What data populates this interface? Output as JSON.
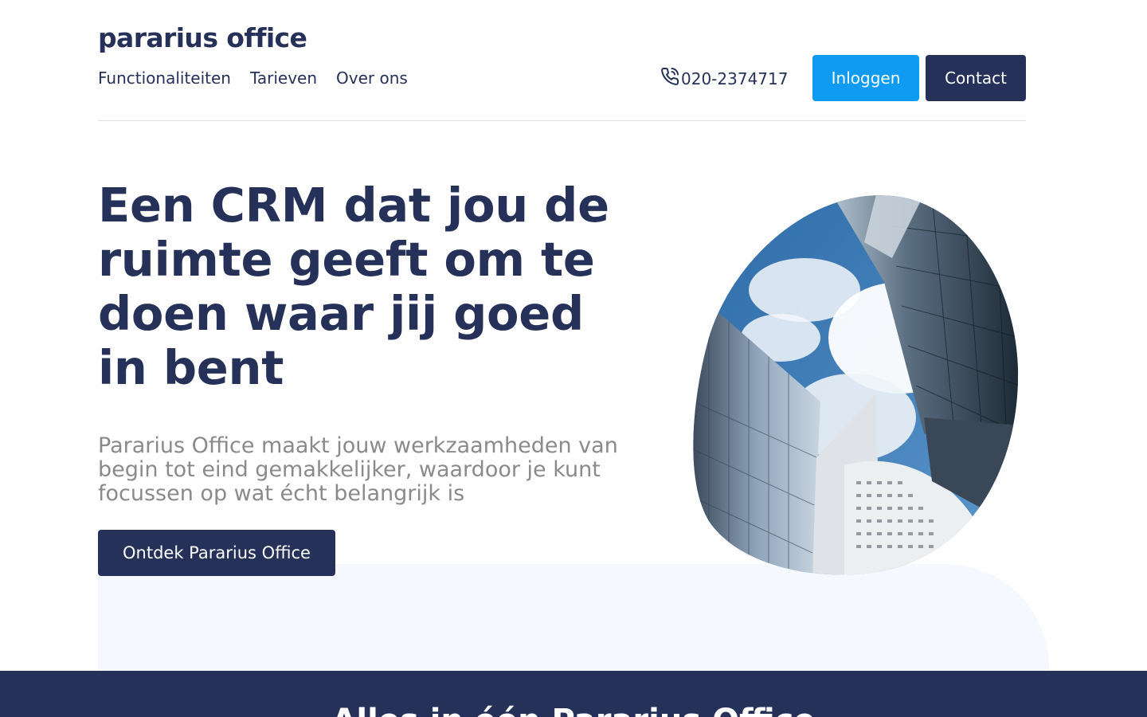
{
  "brand": {
    "logo_text": "pararius office",
    "accent_color": "#0f9bf2",
    "primary_color": "#26315a"
  },
  "nav": {
    "items": [
      {
        "label": "Functionaliteiten"
      },
      {
        "label": "Tarieven"
      },
      {
        "label": "Over ons"
      }
    ]
  },
  "header": {
    "phone_icon": "phone-icon",
    "phone": "020-2374717",
    "login_label": "Inloggen",
    "contact_label": "Contact"
  },
  "hero": {
    "title": "Een CRM dat jou de ruimte geeft om te doen waar jij goed in bent",
    "subtitle": "Pararius Office maakt jouw werkzaamheden van begin tot eind gemakkelijker, waardoor je kunt focussen op wat écht belangrijk is",
    "cta_label": "Ontdek Pararius Office",
    "image": "skyscrapers-looking-up-image"
  },
  "footer_band": {
    "heading": "Alles in één Pararius Office"
  }
}
